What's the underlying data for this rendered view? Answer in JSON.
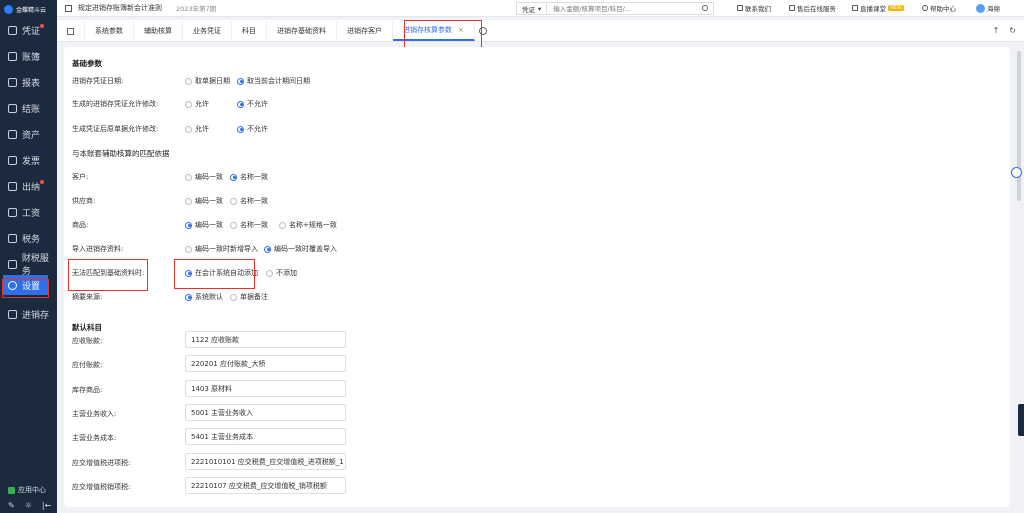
{
  "app": {
    "logo_text": "金蝶精斗云",
    "company": "规定进销存账簿新会计准则",
    "period": "2023年第7期"
  },
  "search": {
    "type": "凭证",
    "placeholder": "输入金额/核算项目/科目/..."
  },
  "top_links": {
    "contact": "联系我们",
    "service": "售后在线服务",
    "live": "直播课堂",
    "live_badge": "NEW",
    "help": "帮助中心",
    "user": "海绵"
  },
  "sidebar": {
    "items": [
      {
        "label": "凭证",
        "dot": true
      },
      {
        "label": "账簿",
        "dot": false
      },
      {
        "label": "报表",
        "dot": false
      },
      {
        "label": "结账",
        "dot": false
      },
      {
        "label": "资产",
        "dot": false
      },
      {
        "label": "发票",
        "dot": false
      },
      {
        "label": "出纳",
        "dot": true
      },
      {
        "label": "工资",
        "dot": false
      },
      {
        "label": "税务",
        "dot": false
      },
      {
        "label": "财税服务",
        "dot": false
      },
      {
        "label": "设置",
        "dot": false,
        "active": true
      },
      {
        "label": "进销存",
        "dot": false
      }
    ],
    "app_center": "应用中心",
    "tools": [
      "✎",
      "☼",
      "|←"
    ]
  },
  "tabs": [
    {
      "label": "系统参数"
    },
    {
      "label": "辅助核算"
    },
    {
      "label": "业务凭证"
    },
    {
      "label": "科目"
    },
    {
      "label": "进销存基础资料"
    },
    {
      "label": "进销存客户"
    },
    {
      "label": "进销存核算参数",
      "active": true,
      "close": "×"
    }
  ],
  "tab_controls": [
    "↑",
    "↻"
  ],
  "form": {
    "basic_title": "基础参数",
    "rows": [
      {
        "label": "进销存凭证日期:",
        "options": [
          {
            "text": "取单据日期",
            "on": false
          },
          {
            "text": "取当前会计期间日期",
            "on": true
          }
        ]
      },
      {
        "label": "生成的进销存凭证允许修改:",
        "options": [
          {
            "text": "允许",
            "on": false
          },
          {
            "text": "不允许",
            "on": true
          }
        ]
      },
      {
        "label": "生成凭证后原单据允许修改:",
        "options": [
          {
            "text": "允许",
            "on": false
          },
          {
            "text": "不允许",
            "on": true
          }
        ]
      }
    ],
    "match_title": "与本账套辅助核算的匹配依据",
    "match_rows": [
      {
        "label": "客户:",
        "options": [
          {
            "text": "编码一致",
            "on": false
          },
          {
            "text": "名称一致",
            "on": true
          }
        ]
      },
      {
        "label": "供应商:",
        "options": [
          {
            "text": "编码一致",
            "on": false
          },
          {
            "text": "名称一致",
            "on": false
          }
        ]
      },
      {
        "label": "商品:",
        "options": [
          {
            "text": "编码一致",
            "on": true
          },
          {
            "text": "名称一致",
            "on": false
          },
          {
            "text": "名称+规格一致",
            "on": false
          }
        ]
      },
      {
        "label": "导入进销存资料:",
        "options": [
          {
            "text": "编码一致时新增导入",
            "on": false
          },
          {
            "text": "编码一致时覆盖导入",
            "on": true
          }
        ]
      },
      {
        "label": "无法匹配到基础资料时:",
        "options": [
          {
            "text": "在会计系统自动添加",
            "on": true
          },
          {
            "text": "不添加",
            "on": false
          }
        ]
      },
      {
        "label": "摘要来源:",
        "options": [
          {
            "text": "系统默认",
            "on": true
          },
          {
            "text": "单据备注",
            "on": false
          }
        ]
      }
    ],
    "default_title": "默认科目",
    "accounts": [
      {
        "label": "应收账款:",
        "value": "1122 应收账款"
      },
      {
        "label": "应付账款:",
        "value": "220201 应付账款_大桥"
      },
      {
        "label": "库存商品:",
        "value": "1403 原材料"
      },
      {
        "label": "主营业务收入:",
        "value": "5001 主营业务收入"
      },
      {
        "label": "主营业务成本:",
        "value": "5401 主营业务成本"
      },
      {
        "label": "应交增值税进项税:",
        "value": "2221010101 应交税费_应交增值税_进项税额_1"
      },
      {
        "label": "应交增值税销项税:",
        "value": "22210107 应交税费_应交增值税_销项税额"
      }
    ]
  },
  "colors": {
    "sidebar_bg": "#1c2a3f",
    "accent": "#2f6fe8",
    "highlight": "#e0352b"
  }
}
